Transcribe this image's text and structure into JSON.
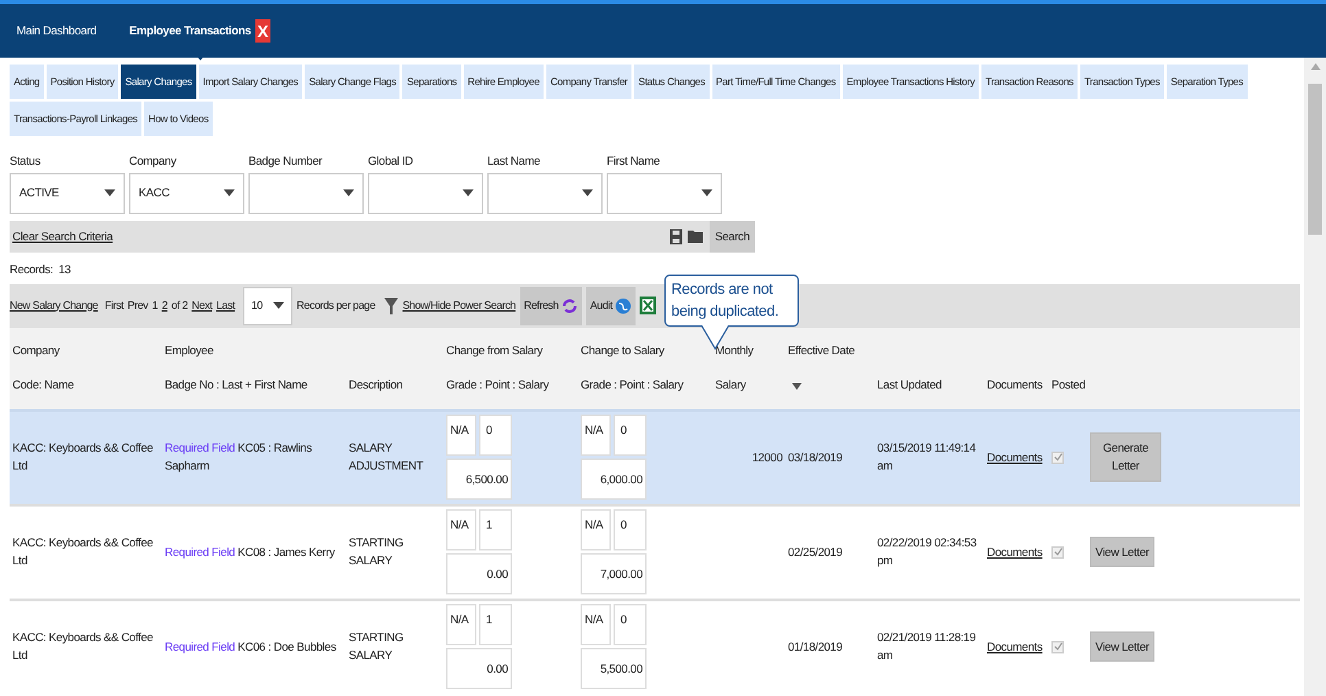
{
  "nav": [
    {
      "label": "Main Dashboard",
      "selected": false,
      "closable": false
    },
    {
      "label": "Employee Transactions",
      "selected": true,
      "closable": true
    }
  ],
  "close_label": "X",
  "subtabs": [
    {
      "label": "Acting",
      "selected": false
    },
    {
      "label": "Position History",
      "selected": false
    },
    {
      "label": "Salary Changes",
      "selected": true
    },
    {
      "label": "Import Salary Changes",
      "selected": false
    },
    {
      "label": "Salary Change Flags",
      "selected": false
    },
    {
      "label": "Separations",
      "selected": false
    },
    {
      "label": "Rehire Employee",
      "selected": false
    },
    {
      "label": "Company Transfer",
      "selected": false
    },
    {
      "label": "Status Changes",
      "selected": false
    },
    {
      "label": "Part Time/Full Time Changes",
      "selected": false
    },
    {
      "label": "Employee Transactions History",
      "selected": false
    },
    {
      "label": "Transaction Reasons",
      "selected": false
    },
    {
      "label": "Transaction Types",
      "selected": false
    },
    {
      "label": "Separation Types",
      "selected": false
    },
    {
      "label": "Transactions-Payroll Linkages",
      "selected": false
    },
    {
      "label": "How to Videos",
      "selected": false
    }
  ],
  "filters": [
    {
      "label": "Status",
      "value": "ACTIVE"
    },
    {
      "label": "Company",
      "value": "KACC"
    },
    {
      "label": "Badge Number"
    },
    {
      "label": "Global ID"
    },
    {
      "label": "Last Name"
    },
    {
      "label": "First Name"
    }
  ],
  "search_bar": {
    "clear_link": "Clear Search Criteria",
    "search_button": "Search"
  },
  "records": {
    "label": "Records:",
    "count": "13"
  },
  "toolbar": {
    "new_link": "New Salary Change",
    "first": "First",
    "prev": "Prev",
    "pages": [
      {
        "label": "1",
        "selected": true
      },
      {
        "label": "2",
        "selected": false
      }
    ],
    "of": "of 2",
    "next": "Next",
    "last": "Last",
    "per_page": "10",
    "per_page_label": "Records per page",
    "power_search": "Show/Hide Power Search",
    "refresh": "Refresh",
    "audit": "Audit"
  },
  "callout": "Records are not being duplicated.",
  "columns": [
    {
      "top": "Company",
      "bottom": "Code: Name"
    },
    {
      "top": "Employee",
      "bottom": "Badge No : Last + First Name"
    },
    {
      "bottom": "Description"
    },
    {
      "top": "Change from Salary",
      "bottom": "Grade : Point : Salary"
    },
    {
      "top": "Change to Salary",
      "bottom": "Grade : Point : Salary"
    },
    {
      "top": "Monthly",
      "bottom": "Salary"
    },
    {
      "top": "Effective Date",
      "sort": true
    },
    {
      "bottom": "Last Updated"
    },
    {
      "bottom": "Documents"
    },
    {
      "bottom": "Posted"
    }
  ],
  "rows": [
    {
      "selected": true,
      "company": "KACC: Keyboards && Coffee Ltd",
      "required": "Required Field",
      "employee": "KC05 : Rawlins Sapharm",
      "description": "SALARY ADJUSTMENT",
      "from": {
        "grade": "N/A",
        "point": "0",
        "salary": "6,500.00"
      },
      "to": {
        "grade": "N/A",
        "point": "0",
        "salary": "6,000.00"
      },
      "monthly": "12000",
      "effective": "03/18/2019",
      "updated": "03/15/2019 11:49:14 am",
      "documents": "Documents",
      "posted": true,
      "action": "Generate Letter"
    },
    {
      "selected": false,
      "company": "KACC: Keyboards && Coffee Ltd",
      "required": "Required Field",
      "employee": "KC08 : James Kerry",
      "description": "STARTING SALARY",
      "from": {
        "grade": "N/A",
        "point": "1",
        "salary": "0.00"
      },
      "to": {
        "grade": "N/A",
        "point": "0",
        "salary": "7,000.00"
      },
      "effective": "02/25/2019",
      "updated": "02/22/2019 02:34:53 pm",
      "documents": "Documents",
      "posted": true,
      "action": "View Letter"
    },
    {
      "selected": false,
      "company": "KACC: Keyboards && Coffee Ltd",
      "required": "Required Field",
      "employee": "KC06 : Doe Bubbles",
      "description": "STARTING SALARY",
      "from": {
        "grade": "N/A",
        "point": "1",
        "salary": "0.00"
      },
      "to": {
        "grade": "N/A",
        "point": "0",
        "salary": "5,500.00"
      },
      "effective": "01/18/2019",
      "updated": "02/21/2019 11:28:19 am",
      "documents": "Documents",
      "posted": true,
      "action": "View Letter"
    }
  ]
}
